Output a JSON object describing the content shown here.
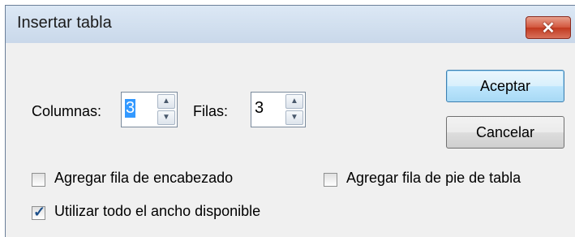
{
  "window": {
    "title": "Insertar tabla"
  },
  "fields": {
    "columns_label": "Columnas:",
    "columns_value": "3",
    "rows_label": "Filas:",
    "rows_value": "3"
  },
  "buttons": {
    "ok": "Aceptar",
    "cancel": "Cancelar"
  },
  "options": {
    "header_row": {
      "label": "Agregar fila de encabezado",
      "checked": false
    },
    "footer_row": {
      "label": "Agregar fila de pie de tabla",
      "checked": false
    },
    "full_width": {
      "label": "Utilizar todo el ancho disponible",
      "checked": true
    }
  },
  "icons": {
    "close": "close-icon",
    "spin_up": "spin-up-icon",
    "spin_down": "spin-down-icon",
    "check": "checkmark-icon"
  },
  "colors": {
    "title_bar": "#dce8f5",
    "close_button": "#c1391f",
    "selection": "#3399ff",
    "default_button": "#a7d9f5"
  }
}
